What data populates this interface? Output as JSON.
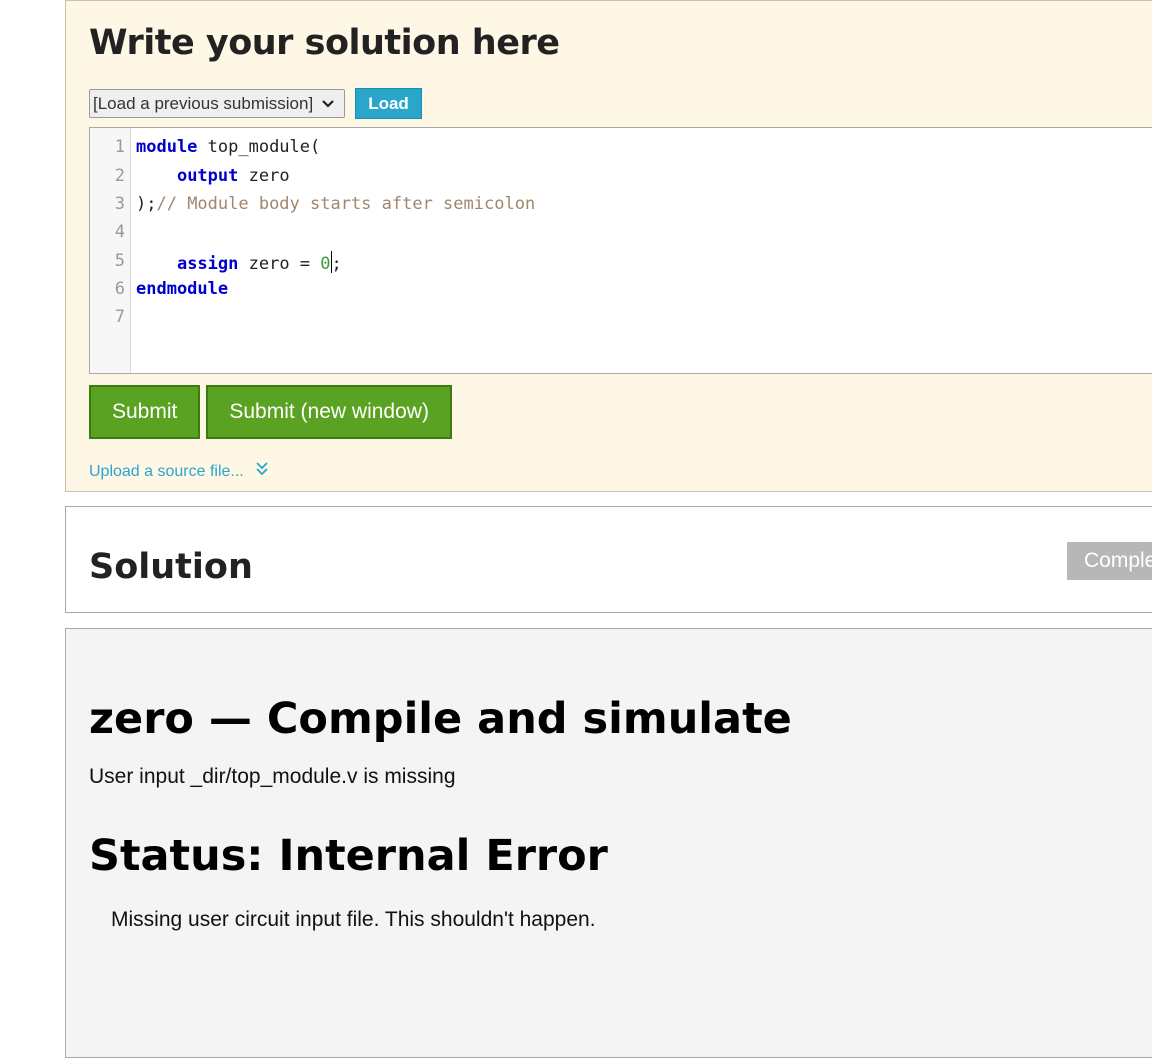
{
  "editor_panel": {
    "heading": "Write your solution here",
    "select_value": "[Load a previous submission]",
    "load_label": "Load",
    "code_lines": [
      {
        "num": "1"
      },
      {
        "num": "2"
      },
      {
        "num": "3"
      },
      {
        "num": "4"
      },
      {
        "num": "5"
      },
      {
        "num": "6"
      },
      {
        "num": "7"
      }
    ],
    "code": {
      "l1_kw": "module",
      "l1_rest": " top_module(",
      "l2_indent": "    ",
      "l2_kw": "output",
      "l2_rest": " zero",
      "l3_code": ");",
      "l3_comment": "// Module body starts after semicolon",
      "l5_indent": "    ",
      "l5_kw": "assign",
      "l5_rest": " zero = ",
      "l5_num": "0",
      "l5_end": ";",
      "l6_kw": "endmodule"
    },
    "submit_label": "Submit",
    "submit_new_label": "Submit (new window)",
    "upload_label": "Upload a source file..."
  },
  "solution_panel": {
    "heading": "Solution",
    "complete_label": "Complete"
  },
  "result_panel": {
    "title": "zero — Compile and simulate",
    "message": "User input _dir/top_module.v is missing",
    "status_heading": "Status: Internal Error",
    "status_message": "Missing user circuit input file. This shouldn't happen."
  },
  "colors": {
    "accent": "#2ba6cb",
    "submit_green": "#5aa322",
    "editor_bg": "#fff7e6"
  }
}
